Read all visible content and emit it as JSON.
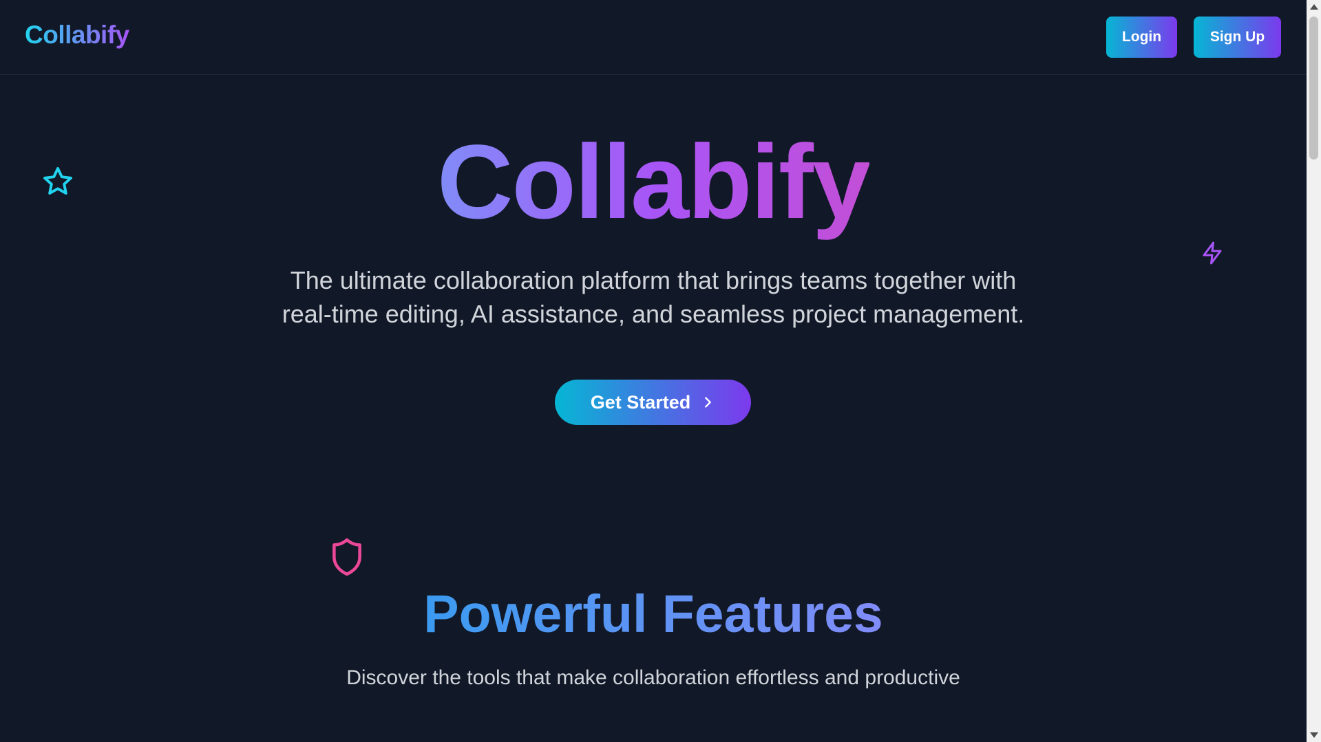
{
  "navbar": {
    "brand": "Collabify",
    "login_label": "Login",
    "signup_label": "Sign Up"
  },
  "hero": {
    "title": "Collabify",
    "subtitle_line1": "The ultimate collaboration platform that brings teams together with",
    "subtitle_line2": "real-time editing, AI assistance, and seamless project management.",
    "cta_label": "Get Started",
    "cta_icon": "chevron-right-icon"
  },
  "decorations": {
    "star_icon": "star-icon",
    "bolt_icon": "lightning-bolt-icon",
    "shield_icon": "shield-icon"
  },
  "features": {
    "title": "Powerful Features",
    "subtitle": "Discover the tools that make collaboration effortless and productive"
  },
  "colors": {
    "background": "#111827",
    "accent_cyan": "#06b6d4",
    "accent_purple": "#7c3aed",
    "star_color": "#22d3ee",
    "bolt_color": "#a855f7",
    "shield_color": "#ec4899"
  }
}
